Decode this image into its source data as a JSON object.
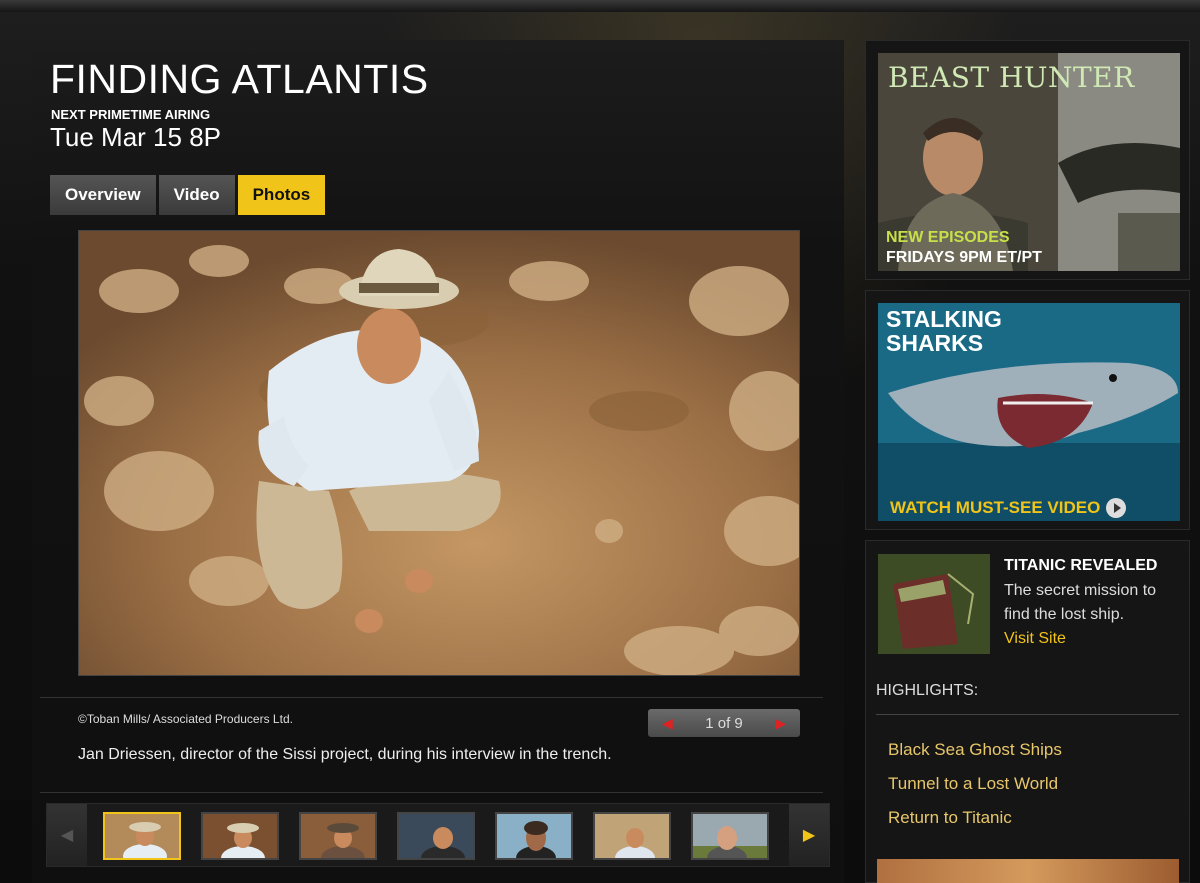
{
  "show": {
    "title": "FINDING ATLANTIS",
    "airing_label": "NEXT PRIMETIME AIRING",
    "airing_time": "Tue Mar 15 8P"
  },
  "tabs": [
    {
      "label": "Overview",
      "active": false
    },
    {
      "label": "Video",
      "active": false
    },
    {
      "label": "Photos",
      "active": true
    }
  ],
  "gallery": {
    "credit": "©Toban Mills/ Associated Producers Ltd.",
    "pager": {
      "prev": "◀",
      "count": "1 of 9",
      "next": "▶"
    },
    "caption": "Jan Driessen, director of the Sissi project, during his interview in the trench.",
    "strip": {
      "prev": "◀",
      "next": "▶"
    },
    "thumbnail_count": 7
  },
  "sidebar": {
    "beast_hunter": {
      "title": "BEAST HUNTER",
      "line1": "NEW EPISODES",
      "line2": "FRIDAYS 9PM ET/PT"
    },
    "stalking_sharks": {
      "title": "STALKING SHARKS",
      "cta": "WATCH MUST-SEE VIDEO"
    },
    "titanic": {
      "title": "TITANIC REVEALED",
      "description": "The secret mission to find the lost ship.",
      "link": "Visit Site"
    },
    "highlights": {
      "label": "HIGHLIGHTS:",
      "items": [
        "Black Sea Ghost Ships",
        "Tunnel to a Lost World",
        "Return to Titanic"
      ]
    }
  },
  "colors": {
    "accent": "#f0c419",
    "link": "#e8c66a",
    "pager_arrow": "#d22222",
    "background": "#0b0b0b"
  }
}
